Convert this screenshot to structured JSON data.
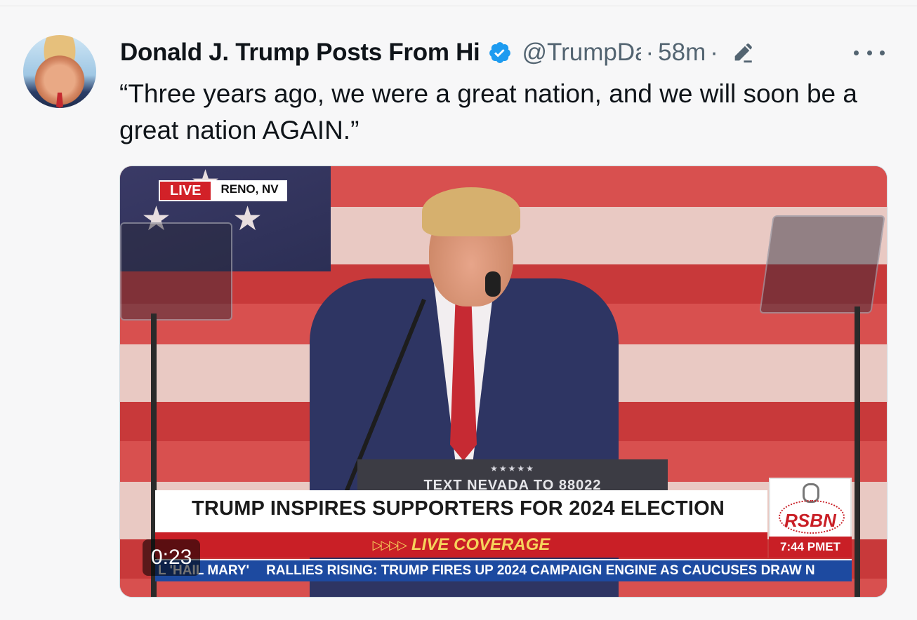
{
  "post": {
    "author_name": "Donald J. Trump Posts From Hi",
    "handle": "@TrumpDa",
    "time": "58m",
    "separator": "·",
    "text": "“Three years ago, we were a great nation, and we will soon be a great nation AGAIN.”"
  },
  "icons": {
    "verified": "verified-badge-icon",
    "edit": "edit-pencil-icon",
    "more": "more-dots-icon"
  },
  "video": {
    "duration": "0:23",
    "live_label": "LIVE",
    "location": "RENO, NV",
    "podium_stars": "★★★★★",
    "podium_text": "TEXT NEVADA TO 88022",
    "banner_title": "TRUMP INSPIRES SUPPORTERS FOR 2024 ELECTION",
    "coverage_arrows": "▷▷▷▷",
    "coverage_label": "LIVE COVERAGE",
    "logo": "RSBN",
    "logo_time": "7:44 PMET",
    "ticker_left": "L 'HAIL MARY'",
    "ticker_main": "RALLIES RISING: TRUMP FIRES UP 2024 CAMPAIGN ENGINE AS CAUCUSES DRAW N"
  },
  "colors": {
    "verified_blue": "#1d9bf0",
    "text_primary": "#0f1419",
    "text_secondary": "#536471",
    "live_red": "#d22128",
    "ticker_blue": "#1d4aa0"
  }
}
